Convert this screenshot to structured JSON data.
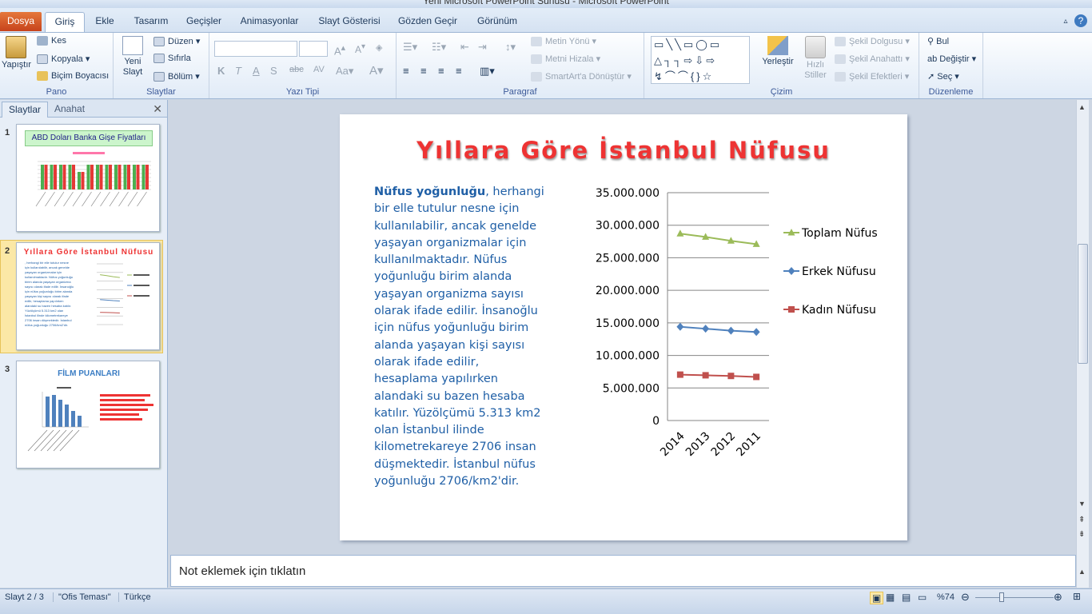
{
  "window": {
    "title": "Yeni Microsoft PowerPoint Sunusu - Microsoft PowerPoint"
  },
  "tabs": [
    "Dosya",
    "Giriş",
    "Ekle",
    "Tasarım",
    "Geçişler",
    "Animasyonlar",
    "Slayt Gösterisi",
    "Gözden Geçir",
    "Görünüm"
  ],
  "ribbon": {
    "pano": {
      "label": "Pano",
      "paste": "Yapıştır",
      "cut": "Kes",
      "copy": "Kopyala",
      "format_painter": "Biçim Boyacısı"
    },
    "slaytlar": {
      "label": "Slaytlar",
      "new_slide_1": "Yeni",
      "new_slide_2": "Slayt",
      "layout": "Düzen",
      "reset": "Sıfırla",
      "section": "Bölüm"
    },
    "yazi_tipi": {
      "label": "Yazı Tipi"
    },
    "paragraf": {
      "label": "Paragraf",
      "text_direction": "Metin Yönü",
      "align_text": "Metni Hizala",
      "smartart": "SmartArt'a Dönüştür"
    },
    "cizim": {
      "label": "Çizim",
      "arrange": "Yerleştir",
      "quick_styles_1": "Hızlı",
      "quick_styles_2": "Stiller",
      "shape_fill": "Şekil Dolgusu",
      "shape_outline": "Şekil Anahattı",
      "shape_effects": "Şekil Efektleri"
    },
    "duzenleme": {
      "label": "Düzenleme",
      "find": "Bul",
      "replace": "Değiştir",
      "select": "Seç"
    }
  },
  "left_pane": {
    "tab_slides": "Slaytlar",
    "tab_outline": "Anahat",
    "thumbs": [
      {
        "num": "1",
        "title": "ABD Doları Banka Gişe Fiyatları"
      },
      {
        "num": "2",
        "title": "Yıllara Göre İstanbul Nüfusu"
      },
      {
        "num": "3",
        "title": "FİLM PUANLARI"
      }
    ]
  },
  "slide": {
    "title": "Yıllara Göre İstanbul Nüfusu",
    "body_bold": "Nüfus yoğunluğu",
    "body_rest": ", herhangi bir elle tutulur nesne için kullanılabilir, ancak genelde yaşayan organizmalar için kullanılmaktadır. Nüfus yoğunluğu birim alanda yaşayan organizma sayısı olarak ifade edilir. İnsanoğlu için nüfus yoğunluğu birim alanda yaşayan kişi sayısı olarak ifade edilir, hesaplama yapılırken alandaki su bazen hesaba katılır. Yüzölçümü 5.313 km2 olan İstanbul ilinde kilometrekareye 2706 insan düşmektedir. İstanbul nüfus yoğunluğu 2706/km2'dir."
  },
  "chart_data": {
    "type": "line",
    "categories": [
      "2014",
      "2013",
      "2012",
      "2011"
    ],
    "ylim": [
      0,
      35000000
    ],
    "yticks": [
      "0",
      "5.000.000",
      "10.000.000",
      "15.000.000",
      "20.000.000",
      "25.000.000",
      "30.000.000",
      "35.000.000"
    ],
    "legend_position": "right",
    "grid": true,
    "series": [
      {
        "name": "Toplam Nüfus",
        "values": [
          28700000,
          28200000,
          27600000,
          27100000
        ],
        "color": "#9bbb59",
        "marker": "triangle"
      },
      {
        "name": "Erkek Nüfusu",
        "values": [
          14400000,
          14100000,
          13800000,
          13600000
        ],
        "color": "#4f81bd",
        "marker": "diamond"
      },
      {
        "name": "Kadın Nüfusu",
        "values": [
          7050000,
          6950000,
          6850000,
          6700000
        ],
        "color": "#c0504d",
        "marker": "square"
      }
    ]
  },
  "notes": {
    "placeholder": "Not eklemek için tıklatın"
  },
  "status": {
    "slide": "Slayt 2 / 3",
    "theme": "\"Ofis Teması\"",
    "language": "Türkçe",
    "zoom": "%74"
  }
}
